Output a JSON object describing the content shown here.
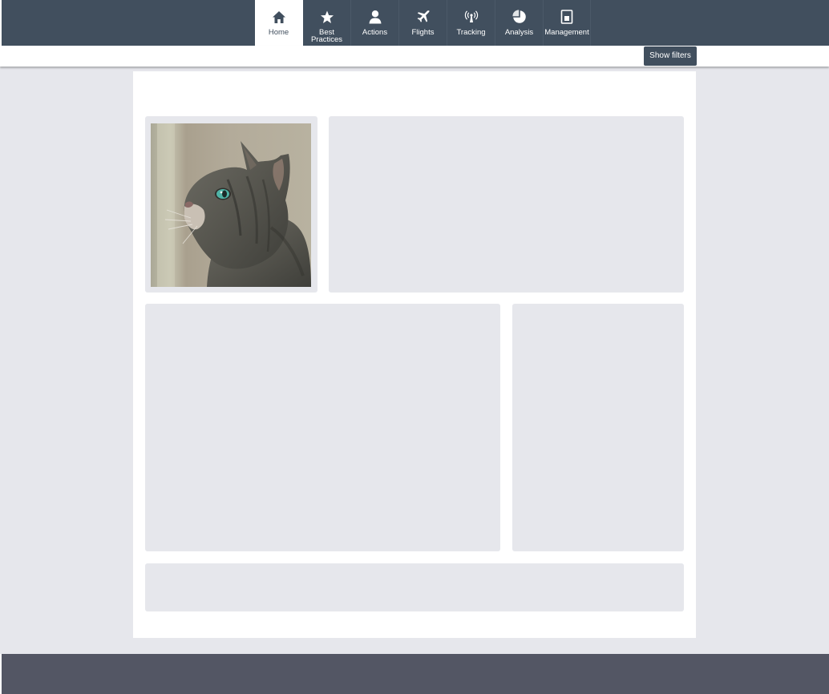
{
  "nav": {
    "items": [
      {
        "label": "Home",
        "icon": "home-icon",
        "active": true
      },
      {
        "label": "Best Practices",
        "icon": "star-icon",
        "active": false
      },
      {
        "label": "Actions",
        "icon": "person-icon",
        "active": false
      },
      {
        "label": "Flights",
        "icon": "plane-icon",
        "active": false
      },
      {
        "label": "Tracking",
        "icon": "antenna-icon",
        "active": false
      },
      {
        "label": "Analysis",
        "icon": "pie-chart-icon",
        "active": false
      },
      {
        "label": "Management",
        "icon": "document-icon",
        "active": false
      }
    ]
  },
  "toolbar": {
    "show_filters_label": "Show filters"
  },
  "colors": {
    "header": "#414f5e",
    "page_background": "#e6e7ec",
    "footer": "#535664",
    "panel": "#e6e7ec"
  }
}
